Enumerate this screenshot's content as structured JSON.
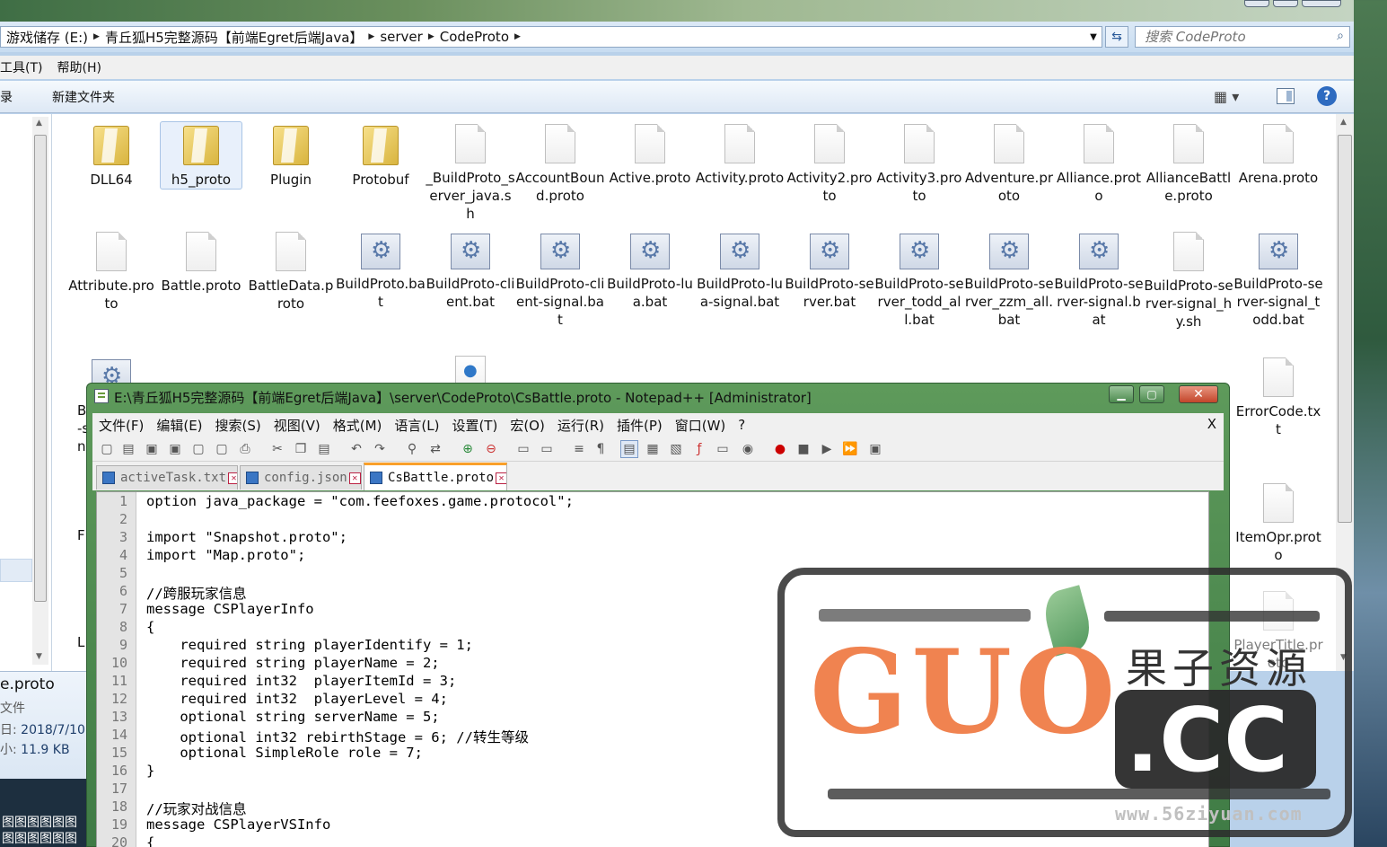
{
  "explorer": {
    "breadcrumb": [
      "游戏储存 (E:)",
      "青丘狐H5完整源码【前端Egret后端Java】",
      "server",
      "CodeProto"
    ],
    "search_placeholder": "搜索 CodeProto",
    "menu": [
      "工具(T)",
      "帮助(H)"
    ],
    "toolbar": {
      "left_label": "录",
      "new_folder_label": "新建文件夹"
    },
    "files_row1": [
      "DLL64",
      "h5_proto",
      "Plugin",
      "Protobuf",
      "_BuildProto_server_java.sh",
      "AccountBound.proto",
      "Active.proto",
      "Activity.proto",
      "Activity2.proto",
      "Activity3.proto",
      "Adventure.proto",
      "Alliance.proto",
      "AllianceBattle.proto",
      "Arena.proto"
    ],
    "files_row2": [
      "Attribute.proto",
      "Battle.proto",
      "BattleData.proto",
      "BuildProto.bat",
      "BuildProto-client.bat",
      "BuildProto-client-signal.bat",
      "BuildProto-lua.bat",
      "BuildProto-lua-signal.bat",
      "BuildProto-server.bat",
      "BuildProto-server_todd_all.bat",
      "BuildProto-server_zzm_all.bat",
      "BuildProto-server-signal.bat",
      "BuildProto-server-signal_hy.sh",
      "BuildProto-server-signal_todd.bat"
    ],
    "files_right": [
      "ErrorCode.txt",
      "ItemOpr.proto",
      "PlayerTitle.proto"
    ],
    "partial_labels": [
      "B",
      "-s",
      "n",
      "F",
      "L"
    ],
    "details": {
      "name": "e.proto",
      "type": "文件",
      "date_label": "日:",
      "date_value": "2018/7/10",
      "size_label": "小:",
      "size_value": "11.9 KB"
    },
    "taskbar_text": "图图图图图图图图图图图图"
  },
  "npp": {
    "title": "E:\\青丘狐H5完整源码【前端Egret后端Java】\\server\\CodeProto\\CsBattle.proto - Notepad++ [Administrator]",
    "menu": [
      "文件(F)",
      "编辑(E)",
      "搜索(S)",
      "视图(V)",
      "格式(M)",
      "语言(L)",
      "设置(T)",
      "宏(O)",
      "运行(R)",
      "插件(P)",
      "窗口(W)",
      "?"
    ],
    "close_doc": "X",
    "tabs": [
      {
        "label": "activeTask.txt",
        "active": false
      },
      {
        "label": "config.json",
        "active": false
      },
      {
        "label": "CsBattle.proto",
        "active": true
      }
    ],
    "lines": [
      {
        "n": "1",
        "code": "option java_package = \"com.feefoxes.game.protocol\";"
      },
      {
        "n": "2",
        "code": ""
      },
      {
        "n": "3",
        "code": "import \"Snapshot.proto\";"
      },
      {
        "n": "4",
        "code": "import \"Map.proto\";"
      },
      {
        "n": "5",
        "code": ""
      },
      {
        "n": "6",
        "code": "//跨服玩家信息"
      },
      {
        "n": "7",
        "code": "message CSPlayerInfo"
      },
      {
        "n": "8",
        "code": "{"
      },
      {
        "n": "9",
        "code": "    required string playerIdentify = 1;"
      },
      {
        "n": "10",
        "code": "    required string playerName = 2;"
      },
      {
        "n": "11",
        "code": "    required int32  playerItemId = 3;"
      },
      {
        "n": "12",
        "code": "    required int32  playerLevel = 4;"
      },
      {
        "n": "13",
        "code": "    optional string serverName = 5;"
      },
      {
        "n": "14",
        "code": "    optional int32 rebirthStage = 6; //转生等级"
      },
      {
        "n": "15",
        "code": "    optional SimpleRole role = 7;"
      },
      {
        "n": "16",
        "code": "}"
      },
      {
        "n": "17",
        "code": ""
      },
      {
        "n": "18",
        "code": "//玩家对战信息"
      },
      {
        "n": "19",
        "code": "message CSPlayerVSInfo"
      },
      {
        "n": "20",
        "code": "{"
      }
    ]
  },
  "watermark": {
    "brand": "GUO",
    "cn": "果子资源",
    "tld": ".CC",
    "url": "www.56ziyuan.com"
  }
}
